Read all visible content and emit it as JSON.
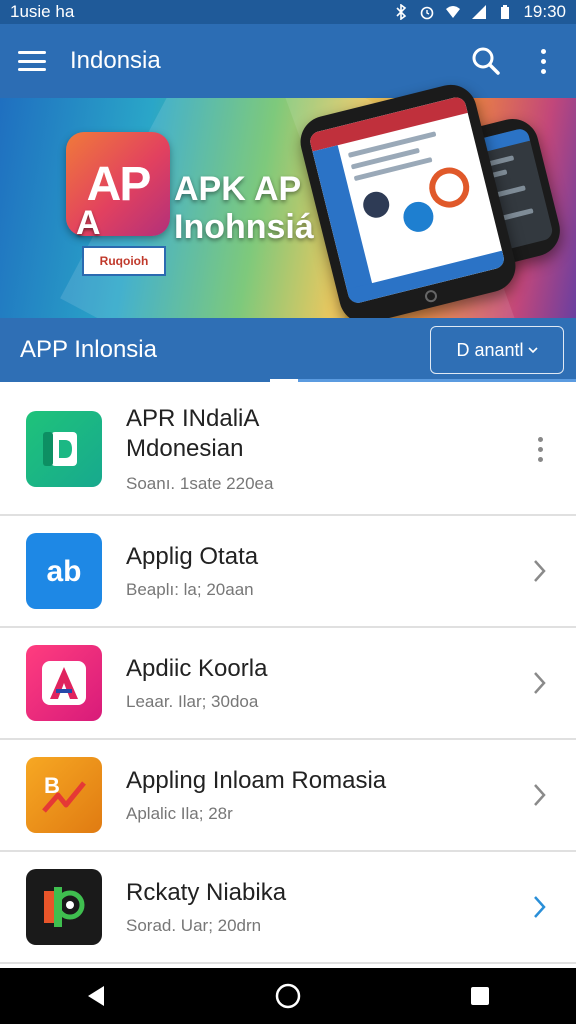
{
  "status_bar": {
    "left_text": "1usie ha",
    "time": "19:30",
    "icons": [
      "bluetooth-icon",
      "alarm-icon",
      "wifi-icon",
      "signal-icon",
      "battery-icon"
    ]
  },
  "app_bar": {
    "title": "Indonsia",
    "menu_icon": "hamburger-menu-icon",
    "search_icon": "search-icon",
    "more_icon": "more-vert-icon"
  },
  "banner": {
    "logo_text": "AP",
    "logo_sub": "A",
    "tag": "Ruqoioh",
    "title_line1": "APK AP",
    "title_line2": "Inohnsiá"
  },
  "sub_bar": {
    "title": "APP Inlonsia",
    "dropdown_label": "D anantl",
    "dropdown_icon": "chevron-down-icon"
  },
  "apps": [
    {
      "name_line1": "APR INdaliA",
      "name_line2": "Mdonesian",
      "meta": "Soanı. 1sate 220ea",
      "icon": "green-d-app-icon",
      "trailing": "more-vert-icon"
    },
    {
      "name": "Applig Otata",
      "meta": "Beaplı: la; 20aan",
      "icon": "blue-ab-app-icon",
      "trailing": "chevron-right-icon"
    },
    {
      "name": "Apdiic Koorla",
      "meta": "Leaar. Ilar; 30doa",
      "icon": "pink-a-app-icon",
      "trailing": "chevron-right-icon"
    },
    {
      "name": "Appling Inloam Romasia",
      "meta": "Aplalic Ila; 28r",
      "icon": "orange-b-app-icon",
      "trailing": "chevron-right-icon"
    },
    {
      "name": "Rckaty Niabika",
      "meta": "Sorad. Uar; 20drn",
      "icon": "dark-p-app-icon",
      "trailing": "chevron-right-icon"
    }
  ],
  "colors": {
    "status_bar": "#1f5a99",
    "app_bar": "#2c6db4",
    "sub_bar": "#2f6fb5",
    "chevron_accent": "#2a8fd8",
    "chevron_default": "#8a8a8a"
  },
  "nav_bar": {
    "icons": [
      "back-triangle-icon",
      "home-circle-icon",
      "recents-square-icon"
    ]
  }
}
